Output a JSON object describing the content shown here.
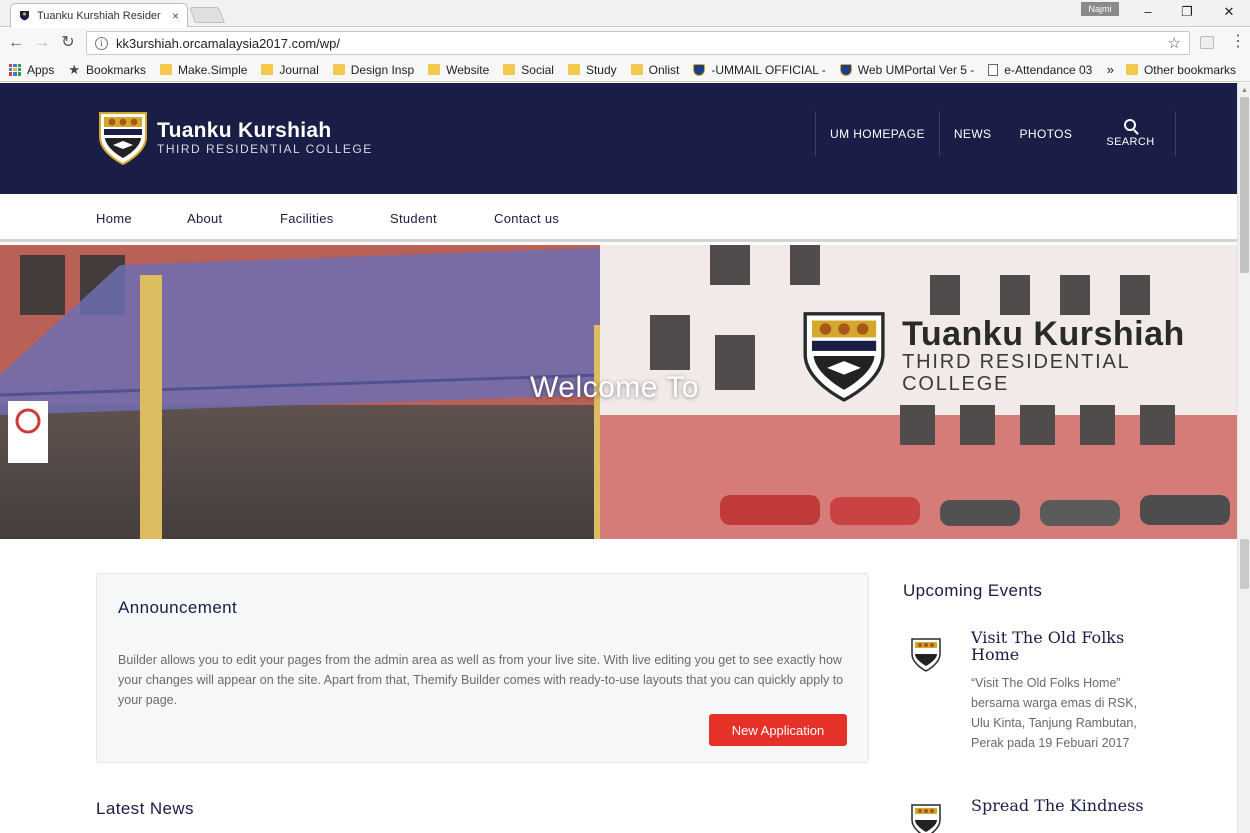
{
  "browser": {
    "tab_title": "Tuanku Kurshiah Resider",
    "tab_close": "×",
    "user_name": "Najmi",
    "win_minimize": "–",
    "win_restore": "❐",
    "win_close": "✕",
    "back": "←",
    "forward": "→",
    "reload": "↻",
    "info": "i",
    "url": "kk3urshiah.orcamalaysia2017.com/wp/",
    "star": "☆",
    "menu": "⋮",
    "bookmarks": [
      {
        "label": "Apps",
        "icon": "apps-grid-icon"
      },
      {
        "label": "Bookmarks",
        "icon": "star-icon"
      },
      {
        "label": "Make.Simple",
        "icon": "folder-icon"
      },
      {
        "label": "Journal",
        "icon": "folder-icon"
      },
      {
        "label": "Design Insp",
        "icon": "folder-icon"
      },
      {
        "label": "Website",
        "icon": "folder-icon"
      },
      {
        "label": "Social",
        "icon": "folder-icon"
      },
      {
        "label": "Study",
        "icon": "folder-icon"
      },
      {
        "label": "Onlist",
        "icon": "folder-icon"
      },
      {
        "label": "-UMMAIL OFFICIAL -",
        "icon": "um-shield-icon"
      },
      {
        "label": "Web UMPortal Ver 5 -",
        "icon": "um-shield-icon"
      },
      {
        "label": "e-Attendance 03",
        "icon": "document-icon"
      }
    ],
    "bookmarks_more": "»",
    "other_bookmarks": "Other bookmarks"
  },
  "site": {
    "logo_title": "Tuanku Kurshiah",
    "logo_subtitle": "THIRD RESIDENTIAL COLLEGE",
    "top_nav": [
      "UM HOMEPAGE",
      "NEWS",
      "PHOTOS"
    ],
    "search_label": "SEARCH",
    "main_nav": [
      "Home",
      "About",
      "Facilities",
      "Student",
      "Contact us"
    ],
    "hero_title": "Welcome To",
    "hero_logo_title": "Tuanku Kurshiah",
    "hero_logo_subtitle": "THIRD RESIDENTIAL COLLEGE",
    "announcement_title": "Announcement",
    "announcement_text": "Builder allows you to edit your pages from the admin area as well as from your live site. With live editing you get to see exactly how your changes will appear on the site. Apart from that, Themify Builder comes with ready-to-use layouts that you can quickly apply to your page.",
    "new_application_label": "New Application",
    "latest_news_title": "Latest News",
    "events_title": "Upcoming Events",
    "events": [
      {
        "title": "Visit The Old Folks Home",
        "desc": "“Visit The Old Folks Home” bersama warga emas di RSK, Ulu Kinta, Tanjung Rambutan, Perak pada 19 Febuari 2017"
      },
      {
        "title": "Spread The Kindness",
        "desc": ""
      }
    ]
  },
  "colors": {
    "header_bg": "#1a1d45",
    "accent_red": "#e53127",
    "crest_gold": "#d4a82a"
  }
}
